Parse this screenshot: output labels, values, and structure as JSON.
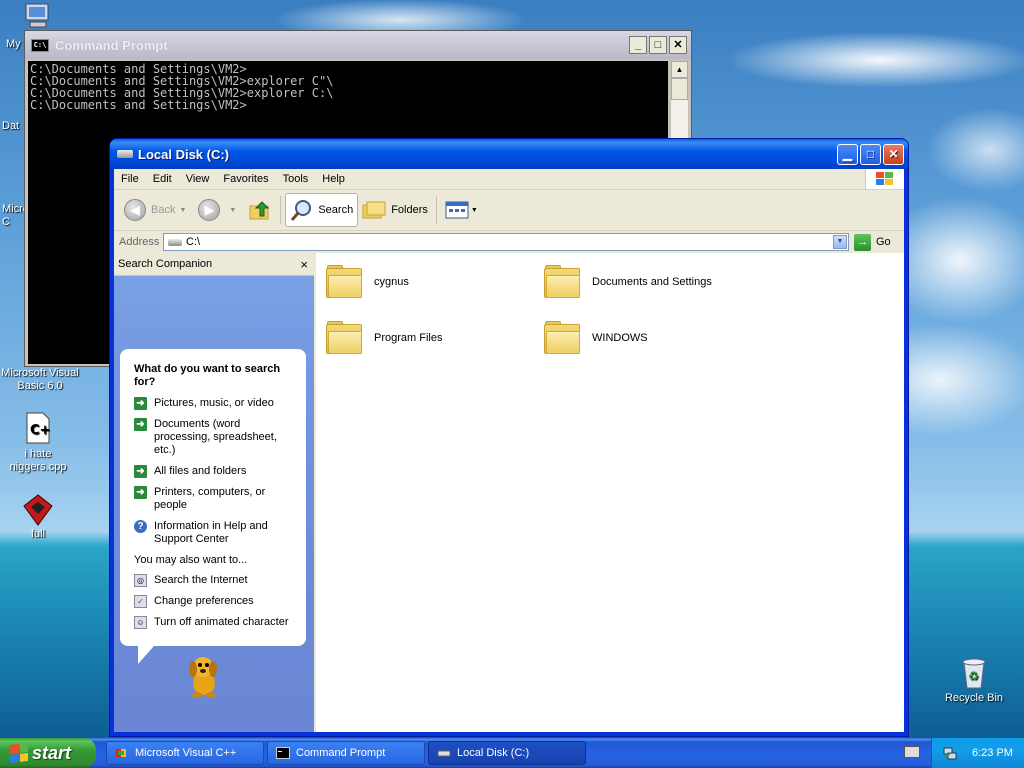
{
  "desktop": {
    "icons": [
      {
        "label": "My",
        "icon": "my-computer-icon"
      },
      {
        "label": "Dat",
        "icon": "database-icon"
      },
      {
        "label": "Micro\nC",
        "icon": "app-icon"
      },
      {
        "label": "Microsoft Visual Basic 6.0",
        "icon": "visual-basic-icon"
      },
      {
        "label": "i hate niggers.cpp",
        "icon": "cpp-file-icon"
      },
      {
        "label": "full",
        "icon": "3d-box-icon"
      },
      {
        "label": "Recycle Bin",
        "icon": "recycle-bin-icon"
      }
    ]
  },
  "cmd": {
    "title": "Command Prompt",
    "icon_text": "C:\\",
    "lines": [
      "C:\\Documents and Settings\\VM2>",
      "C:\\Documents and Settings\\VM2>explorer C\"\\",
      "",
      "C:\\Documents and Settings\\VM2>explorer C:\\",
      "",
      "C:\\Documents and Settings\\VM2>"
    ]
  },
  "explorer": {
    "title": "Local Disk (C:)",
    "menu": [
      "File",
      "Edit",
      "View",
      "Favorites",
      "Tools",
      "Help"
    ],
    "toolbar": {
      "back": "Back",
      "search": "Search",
      "folders": "Folders"
    },
    "address": {
      "label": "Address",
      "value": "C:\\",
      "go": "Go"
    },
    "search_companion": {
      "title": "Search Companion",
      "close": "×",
      "question": "What do you want to search for?",
      "options": [
        "Pictures, music, or video",
        "Documents (word processing, spreadsheet, etc.)",
        "All files and folders",
        "Printers, computers, or people",
        "Information in Help and Support Center"
      ],
      "also_label": "You may also want to...",
      "also": [
        "Search the Internet",
        "Change preferences",
        "Turn off animated character"
      ]
    },
    "files": [
      {
        "name": "cygnus"
      },
      {
        "name": "Documents and Settings"
      },
      {
        "name": "Program Files"
      },
      {
        "name": "WINDOWS"
      }
    ]
  },
  "taskbar": {
    "start": "start",
    "tasks": [
      {
        "label": "Microsoft Visual C++"
      },
      {
        "label": "Command Prompt"
      },
      {
        "label": "Local Disk (C:)"
      }
    ],
    "clock": "6:23 PM"
  },
  "colors": {
    "xp_blue": "#0831d9",
    "start_green": "#3c9a3c",
    "folder_yellow": "#f0cf62"
  }
}
